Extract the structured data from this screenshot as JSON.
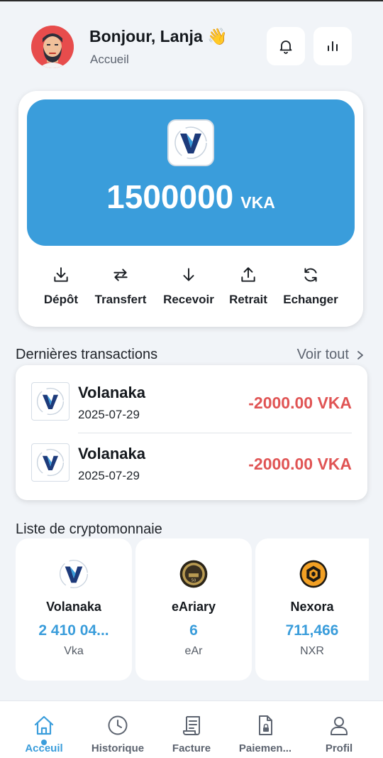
{
  "header": {
    "greeting": "Bonjour, Lanja 👋",
    "subtitle": "Accueil"
  },
  "balance": {
    "amount": "1500000",
    "currency": "VKA"
  },
  "actions": [
    {
      "label": "Dépôt",
      "icon": "download-icon"
    },
    {
      "label": "Transfert",
      "icon": "transfer-icon"
    },
    {
      "label": "Recevoir",
      "icon": "arrow-down-icon"
    },
    {
      "label": "Retrait",
      "icon": "upload-icon"
    },
    {
      "label": "Echanger",
      "icon": "exchange-icon"
    }
  ],
  "transactions": {
    "title": "Dernières transactions",
    "see_all": "Voir tout",
    "items": [
      {
        "name": "Volanaka",
        "date": "2025-07-29",
        "amount": "-2000.00 VKA"
      },
      {
        "name": "Volanaka",
        "date": "2025-07-29",
        "amount": "-2000.00 VKA"
      }
    ]
  },
  "crypto": {
    "title": "Liste de cryptomonnaie",
    "items": [
      {
        "name": "Volanaka",
        "value": "2 410 04...",
        "symbol": "Vka"
      },
      {
        "name": "eAriary",
        "value": "6",
        "symbol": "eAr"
      },
      {
        "name": "Nexora",
        "value": "711,466",
        "symbol": "NXR"
      }
    ]
  },
  "nav": [
    {
      "label": "Acceuil",
      "icon": "home-icon",
      "active": true
    },
    {
      "label": "Historique",
      "icon": "clock-icon"
    },
    {
      "label": "Facture",
      "icon": "receipt-icon"
    },
    {
      "label": "Paiemen...",
      "icon": "payment-document-icon"
    },
    {
      "label": "Profil",
      "icon": "user-icon"
    }
  ],
  "colors": {
    "accent": "#3a9ddb",
    "negative": "#e05454",
    "background": "#f1f4f8"
  }
}
